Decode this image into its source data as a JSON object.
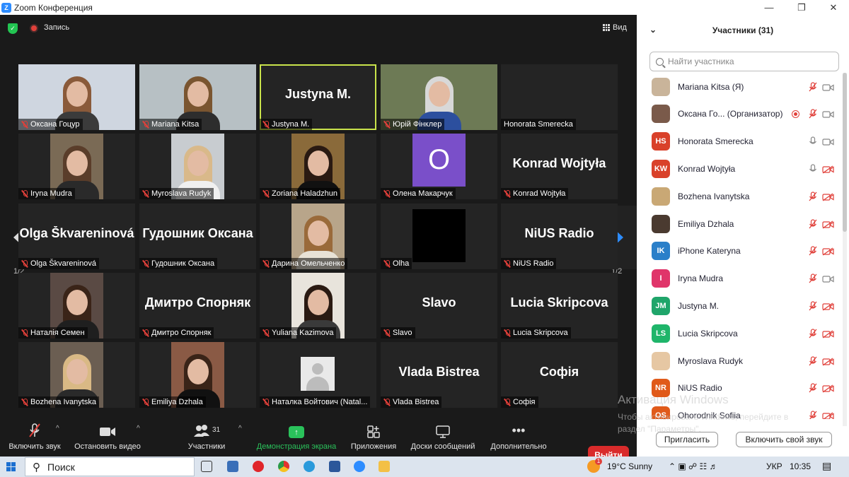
{
  "window": {
    "title": "Zoom Конференция",
    "logo": "Z"
  },
  "topbar": {
    "record_label": "Запись",
    "view_label": "Вид"
  },
  "tiles": [
    {
      "name": "Оксана Гоцур",
      "big": "",
      "type": "photo",
      "hair": "#8a5a3a",
      "body": "#3b3b3b",
      "bg": "#cfd6e0"
    },
    {
      "name": "Mariana Kitsa",
      "big": "",
      "type": "photo",
      "hair": "#7a5530",
      "body": "#2d2d2d",
      "bg": "#b7c0c4"
    },
    {
      "name": "Justyna M.",
      "big": "Justyna M.",
      "type": "text"
    },
    {
      "name": "Юрій Фінклер",
      "big": "",
      "type": "photo",
      "hair": "#d8d8d8",
      "body": "#2c4f9e",
      "bg": "#6d7a55"
    },
    {
      "name": "Honorata Smerecka",
      "big": "",
      "type": "blank"
    },
    {
      "name": "Iryna Mudra",
      "big": "",
      "type": "photo",
      "hair": "#5a3d2a",
      "body": "#2a2a2a",
      "bg": "#7a6a55"
    },
    {
      "name": "Myroslava Rudyk",
      "big": "",
      "type": "photo",
      "hair": "#d9b98a",
      "body": "#f0f0f0",
      "bg": "#c8ccd0"
    },
    {
      "name": "Zoriana Haladzhun",
      "big": "",
      "type": "photo",
      "hair": "#2a1a12",
      "body": "#111111",
      "bg": "#8a6a3a"
    },
    {
      "name": "Олена Макарчук",
      "big": "",
      "type": "letter",
      "letter": "O"
    },
    {
      "name": "Konrad Wojtyła",
      "big": "Konrad Wojtyła",
      "type": "text"
    },
    {
      "name": "Olga Škvareninová",
      "big": "Olga Škvareninová",
      "type": "text"
    },
    {
      "name": "Гудошник Оксана",
      "big": "Гудошник Оксана",
      "type": "text"
    },
    {
      "name": "Дарина Омельченко",
      "big": "",
      "type": "photo",
      "hair": "#9a6a3a",
      "body": "#e8e2d6",
      "bg": "#b8a58a"
    },
    {
      "name": "Olha",
      "big": "",
      "type": "black"
    },
    {
      "name": "NiUS Radio",
      "big": "NiUS Radio",
      "type": "text"
    },
    {
      "name": "Наталія Семен",
      "big": "",
      "type": "photo",
      "hair": "#3a2418",
      "body": "#1f1f1f",
      "bg": "#5a4a44"
    },
    {
      "name": "Дмитро Спорняк",
      "big": "Дмитро Спорняк",
      "type": "text"
    },
    {
      "name": "Yuliana Kazimova",
      "big": "",
      "type": "photo",
      "hair": "#2a1a12",
      "body": "#3a3a3a",
      "bg": "#e8e4dc"
    },
    {
      "name": "Slavo",
      "big": "Slavo",
      "type": "text"
    },
    {
      "name": "Lucia Skripcova",
      "big": "Lucia Skripcova",
      "type": "text"
    },
    {
      "name": "Bozhena Ivanytska",
      "big": "",
      "type": "photo",
      "hair": "#d9b985",
      "body": "#2a2a2a",
      "bg": "#6b5e52"
    },
    {
      "name": "Emiliya Dzhala",
      "big": "",
      "type": "photo",
      "hair": "#3a2418",
      "body": "#111111",
      "bg": "#8a5a45"
    },
    {
      "name": "Наталка Войтович (Natal...",
      "big": "",
      "type": "silhouette"
    },
    {
      "name": "Vlada Bistrea",
      "big": "Vlada Bistrea",
      "type": "text"
    },
    {
      "name": "Софія",
      "big": "Софія",
      "type": "text"
    }
  ],
  "pager": {
    "left": "1/2",
    "right": "1/2"
  },
  "toolbar": {
    "mic": "Включить звук",
    "video": "Остановить видео",
    "participants": "Участники",
    "participants_count": "31",
    "share": "Демонстрация экрана",
    "apps": "Приложения",
    "whiteboards": "Доски сообщений",
    "more": "Дополнительно",
    "leave": "Выйти"
  },
  "panel": {
    "title": "Участники (31)",
    "search_placeholder": "Найти участника",
    "invite": "Пригласить",
    "unmute_self": "Включить свой звук"
  },
  "participants": [
    {
      "name": "Mariana Kitsa (Я)",
      "initials": "",
      "color": "#c9b49a",
      "mic": "off",
      "cam": "on"
    },
    {
      "name": "Оксана Го...  (Организатор)",
      "initials": "",
      "color": "#7a5a4a",
      "mic": "off",
      "cam": "on",
      "rec": true
    },
    {
      "name": "Honorata Smerecka",
      "initials": "HS",
      "color": "#d9412a",
      "mic": "on",
      "cam": "on"
    },
    {
      "name": "Konrad Wojtyła",
      "initials": "KW",
      "color": "#d9412a",
      "mic": "on",
      "cam": "off"
    },
    {
      "name": "Bozhena Ivanytska",
      "initials": "",
      "color": "#c9a875",
      "mic": "off",
      "cam": "off"
    },
    {
      "name": "Emiliya Dzhala",
      "initials": "",
      "color": "#4a3a30",
      "mic": "off",
      "cam": "off"
    },
    {
      "name": "iPhone Kateryna",
      "initials": "IK",
      "color": "#2a7fc9",
      "mic": "off",
      "cam": "off"
    },
    {
      "name": "Iryna Mudra",
      "initials": "I",
      "color": "#e0356a",
      "mic": "off",
      "cam": "on"
    },
    {
      "name": "Justyna M.",
      "initials": "JM",
      "color": "#1fa56a",
      "mic": "off",
      "cam": "off"
    },
    {
      "name": "Lucia Skripcova",
      "initials": "LS",
      "color": "#1fb56a",
      "mic": "off",
      "cam": "off"
    },
    {
      "name": "Myroslava Rudyk",
      "initials": "",
      "color": "#e6c7a3",
      "mic": "off",
      "cam": "off"
    },
    {
      "name": "NiUS Radio",
      "initials": "NR",
      "color": "#e05a1a",
      "mic": "off",
      "cam": "off"
    },
    {
      "name": "Ohorodnik Sofiia",
      "initials": "OS",
      "color": "#e05a1a",
      "mic": "off",
      "cam": "off"
    }
  ],
  "watermark": {
    "line1": "Активация Windows",
    "line2": "Чтобы активировать Windows, перейдите в",
    "line3": "раздел \"Параметры\"."
  },
  "taskbar": {
    "search": "Поиск",
    "weather": "19°C  Sunny",
    "lang": "УКР",
    "time": "10:35",
    "badge": "1"
  },
  "colors": {
    "accent": "#2d8cff",
    "active_speaker": "#c9e34b",
    "leave": "#d92b2b",
    "share": "#2ac25b",
    "muted": "#e0403a"
  }
}
